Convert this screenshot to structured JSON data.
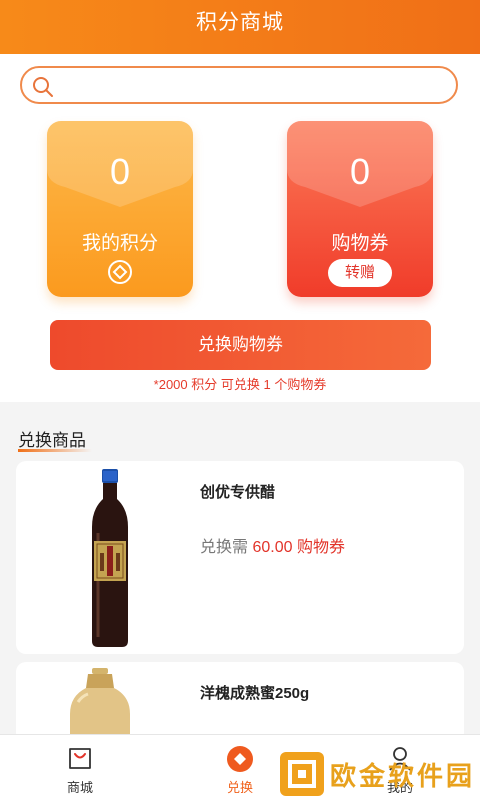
{
  "header": {
    "title": "积分商城"
  },
  "search": {
    "placeholder": ""
  },
  "cards": {
    "points": {
      "value": "0",
      "label": "我的积分"
    },
    "coupons": {
      "value": "0",
      "label": "购物券",
      "button": "转赠"
    }
  },
  "exchange": {
    "button": "兑换购物券",
    "note": "*2000 积分 可兑换 1 个购物券"
  },
  "section": {
    "title": "兑换商品"
  },
  "products": [
    {
      "name": "创优专供醋",
      "price_prefix": "兑换需",
      "price_value": "60.00 购物券"
    },
    {
      "name": "洋槐成熟蜜250g"
    }
  ],
  "nav": [
    {
      "label": "商城"
    },
    {
      "label": "兑换"
    },
    {
      "label": "我的"
    }
  ],
  "watermark": {
    "text": "欧金软件园"
  }
}
